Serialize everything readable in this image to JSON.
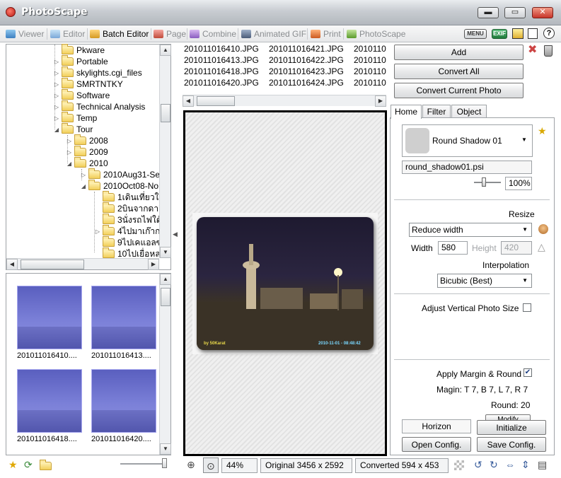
{
  "window": {
    "title": "PhotoScape",
    "minimize": "▬",
    "restore": "▭",
    "close": "✕"
  },
  "tabs": [
    {
      "label": "Viewer",
      "active": false
    },
    {
      "label": "Editor",
      "active": false
    },
    {
      "label": "Batch Editor",
      "active": true
    },
    {
      "label": "Page",
      "active": false
    },
    {
      "label": "Combine",
      "active": false
    },
    {
      "label": "Animated GIF",
      "active": false
    },
    {
      "label": "Print",
      "active": false
    },
    {
      "label": "PhotoScape",
      "active": false
    }
  ],
  "toolbar_icons": {
    "menu": "MENU",
    "exif": "EXIF"
  },
  "tree": {
    "items": [
      {
        "label": "Pkware"
      },
      {
        "label": "Portable"
      },
      {
        "label": "skylights.cgi_files"
      },
      {
        "label": "SMRTNTKY"
      },
      {
        "label": "Software"
      },
      {
        "label": "Technical Analysis"
      },
      {
        "label": "Temp"
      },
      {
        "label": "Tour"
      },
      {
        "label": "2008"
      },
      {
        "label": "2009"
      },
      {
        "label": "2010"
      },
      {
        "label": "2010Aug31-Se"
      },
      {
        "label": "2010Oct08-No"
      },
      {
        "label": "1เดินเที่ยวใน"
      },
      {
        "label": "2บินจากดาอิ"
      },
      {
        "label": "3นั่งรถไฟใต้ด"
      },
      {
        "label": "4ไปมาเก๊าก"
      },
      {
        "label": "9ไปเคแอลซ"
      },
      {
        "label": "10ไปเยื่อหล"
      }
    ]
  },
  "thumbnails": [
    {
      "name": "201011016410...."
    },
    {
      "name": "201011016413...."
    },
    {
      "name": "201011016418...."
    },
    {
      "name": "201011016420...."
    }
  ],
  "file_list": {
    "col1": [
      "201011016410.JPG",
      "201011016413.JPG",
      "201011016418.JPG",
      "201011016420.JPG"
    ],
    "col2": [
      "201011016421.JPG",
      "201011016422.JPG",
      "201011016423.JPG",
      "201011016424.JPG"
    ],
    "col3": [
      "2010110",
      "2010110",
      "2010110",
      "2010110"
    ]
  },
  "preview": {
    "watermark_left": "by 50Karat",
    "watermark_right": "2010-11-01 - 08:48:42"
  },
  "actions": {
    "add": "Add",
    "convert_all": "Convert All",
    "convert_current": "Convert Current Photo"
  },
  "right_tabs": [
    {
      "label": "Home",
      "active": true
    },
    {
      "label": "Filter",
      "active": false
    },
    {
      "label": "Object",
      "active": false
    }
  ],
  "frame": {
    "selected": "Round Shadow 01",
    "file": "round_shadow01.psi",
    "opacity": "100%"
  },
  "resize": {
    "heading": "Resize",
    "mode": "Reduce width",
    "width_label": "Width",
    "width_value": "580",
    "height_label": "Height",
    "height_value": "420",
    "interp_heading": "Interpolation",
    "interp_value": "Bicubic (Best)",
    "adjust_vertical": "Adjust Vertical Photo Size",
    "adjust_vertical_checked": false
  },
  "margin": {
    "apply_label": "Apply Margin & Round",
    "apply_checked": true,
    "magin_text": "Magin: T 7, B 7, L 7, R 7",
    "round_text": "Round: 20",
    "modify_label": "Modify"
  },
  "config": {
    "orient": "Horizon",
    "initialize": "Initialize",
    "open": "Open Config.",
    "save": "Save Config."
  },
  "status": {
    "zoom": "44%",
    "original": "Original 3456 x 2592",
    "converted": "Converted 594 x 453"
  }
}
